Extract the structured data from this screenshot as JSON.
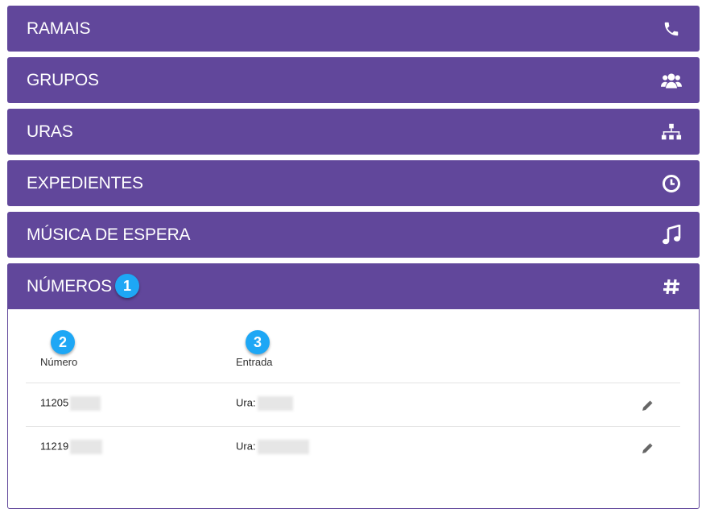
{
  "sections": [
    {
      "label": "RAMAIS",
      "icon": "phone-icon"
    },
    {
      "label": "GRUPOS",
      "icon": "users-icon"
    },
    {
      "label": "URAS",
      "icon": "sitemap-icon"
    },
    {
      "label": "EXPEDIENTES",
      "icon": "clock-icon"
    },
    {
      "label": "MÚSICA DE ESPERA",
      "icon": "music-icon"
    }
  ],
  "numeros": {
    "title": "NÚMEROS",
    "icon": "hashtag-icon",
    "badges": [
      "1",
      "2",
      "3"
    ],
    "columns": [
      "Número",
      "Entrada"
    ],
    "rows": [
      {
        "numero": "11205",
        "entrada": "Ura:"
      },
      {
        "numero": "11219",
        "entrada": "Ura:"
      }
    ]
  },
  "colors": {
    "accent": "#61479b",
    "badge": "#1ea7f5"
  }
}
